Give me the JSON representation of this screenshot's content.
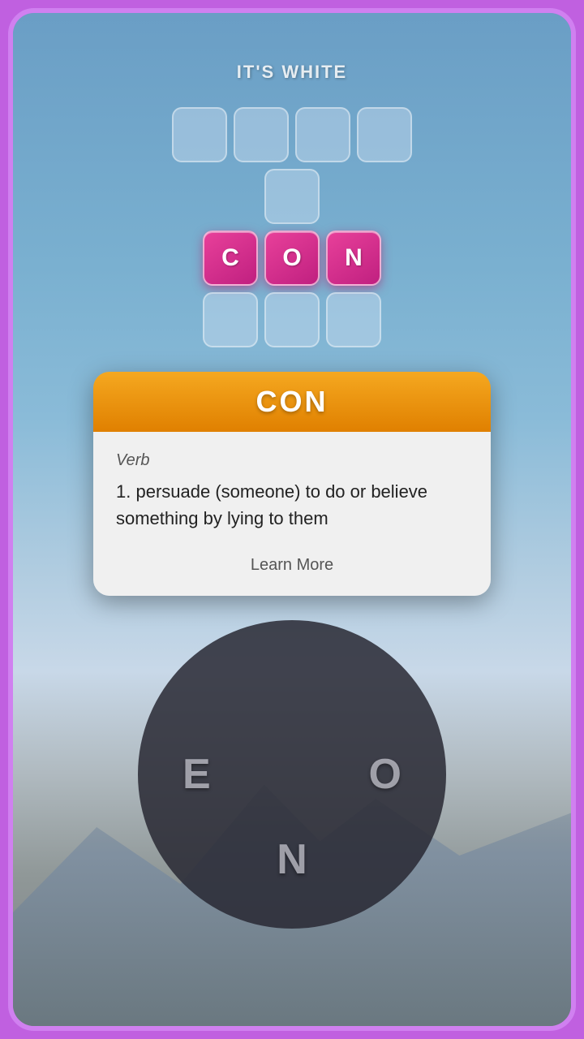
{
  "background": {
    "hint": "IT'S WHITE"
  },
  "puzzle": {
    "rows": [
      {
        "tiles": [
          "",
          "",
          "",
          ""
        ],
        "type": "empty"
      },
      {
        "tiles": [
          ""
        ],
        "type": "empty-single"
      },
      {
        "tiles": [
          "C",
          "O",
          "N"
        ],
        "type": "filled"
      },
      {
        "tiles": [
          "",
          "",
          ""
        ],
        "type": "empty-bottom"
      }
    ]
  },
  "definition_card": {
    "word": "CON",
    "header_color": "#f5a820",
    "part_of_speech": "Verb",
    "definition_number": "1.",
    "definition_text": "persuade (someone) to do or believe something by lying to them",
    "learn_more_label": "Learn More"
  },
  "letter_wheel": {
    "letters": [
      "E",
      "O",
      "N"
    ]
  }
}
